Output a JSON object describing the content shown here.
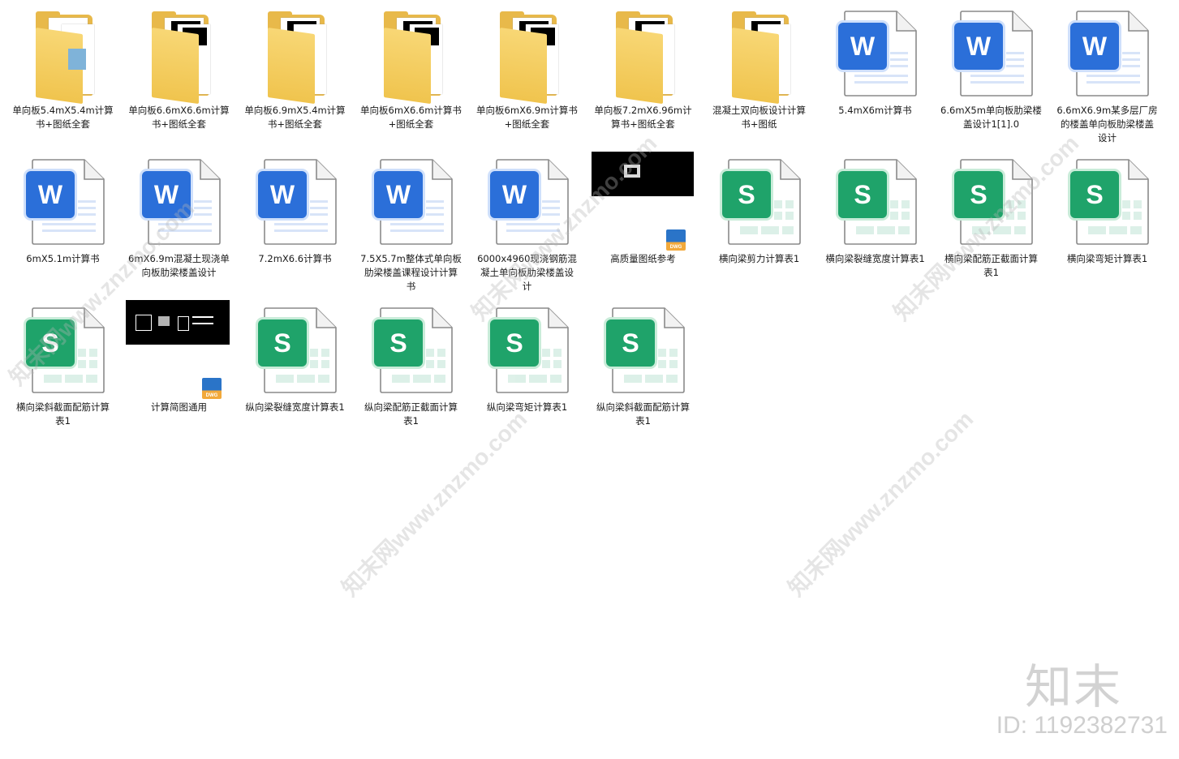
{
  "files": [
    {
      "label": "单向板5.4mX5.4m计算书+图纸全套",
      "kind": "folder",
      "icon": "folder-icon"
    },
    {
      "label": "单向板6.6mX6.6m计算书+图纸全套",
      "kind": "folder",
      "icon": "folder-icon"
    },
    {
      "label": "单向板6.9mX5.4m计算书+图纸全套",
      "kind": "folder",
      "icon": "folder-icon"
    },
    {
      "label": "单向板6mX6.6m计算书+图纸全套",
      "kind": "folder",
      "icon": "folder-icon"
    },
    {
      "label": "单向板6mX6.9m计算书+图纸全套",
      "kind": "folder",
      "icon": "folder-icon"
    },
    {
      "label": "单向板7.2mX6.96m计算书+图纸全套",
      "kind": "folder",
      "icon": "folder-icon"
    },
    {
      "label": "混凝土双向板设计计算书+图纸",
      "kind": "folder",
      "icon": "folder-icon"
    },
    {
      "label": "5.4mX6m计算书",
      "kind": "word",
      "icon": "word-doc-icon"
    },
    {
      "label": "6.6mX5m单向板肋梁楼盖设计1[1].0",
      "kind": "word",
      "icon": "word-doc-icon"
    },
    {
      "label": "6.6mX6.9m某多层厂房的楼盖单向板肋梁楼盖设计",
      "kind": "word",
      "icon": "word-doc-icon"
    },
    {
      "label": "6mX5.1m计算书",
      "kind": "word",
      "icon": "word-doc-icon"
    },
    {
      "label": "6mX6.9m混凝土现浇单向板肋梁楼盖设计",
      "kind": "word",
      "icon": "word-doc-icon"
    },
    {
      "label": "7.2mX6.6计算书",
      "kind": "word",
      "icon": "word-doc-icon"
    },
    {
      "label": "7.5X5.7m整体式单向板肋梁楼盖课程设计计算书",
      "kind": "word",
      "icon": "word-doc-icon"
    },
    {
      "label": "6000x4960现浇钢筋混凝土单向板肋梁楼盖设计",
      "kind": "word",
      "icon": "word-doc-icon"
    },
    {
      "label": "高质量图纸参考",
      "kind": "dwg",
      "icon": "dwg-drawing-icon"
    },
    {
      "label": "横向梁剪力计算表1",
      "kind": "sheet",
      "icon": "spreadsheet-icon"
    },
    {
      "label": "横向梁裂缝宽度计算表1",
      "kind": "sheet",
      "icon": "spreadsheet-icon"
    },
    {
      "label": "横向梁配筋正截面计算表1",
      "kind": "sheet",
      "icon": "spreadsheet-icon"
    },
    {
      "label": "横向梁弯矩计算表1",
      "kind": "sheet",
      "icon": "spreadsheet-icon"
    },
    {
      "label": "横向梁斜截面配筋计算表1",
      "kind": "sheet",
      "icon": "spreadsheet-icon"
    },
    {
      "label": "计算简图通用",
      "kind": "dwg2",
      "icon": "dwg-drawing-icon"
    },
    {
      "label": "纵向梁裂缝宽度计算表1",
      "kind": "sheet",
      "icon": "spreadsheet-icon"
    },
    {
      "label": "纵向梁配筋正截面计算表1",
      "kind": "sheet",
      "icon": "spreadsheet-icon"
    },
    {
      "label": "纵向梁弯矩计算表1",
      "kind": "sheet",
      "icon": "spreadsheet-icon"
    },
    {
      "label": "纵向梁斜截面配筋计算表1",
      "kind": "sheet",
      "icon": "spreadsheet-icon"
    }
  ],
  "word_letter": "W",
  "sheet_letter": "S",
  "dwg_text": "DWG",
  "watermark_text": "知末网www.znzmo.com",
  "brand": "知末",
  "id_text": "ID: 1192382731",
  "colors": {
    "word": "#2b6fd9",
    "sheet": "#1fa36a",
    "folder": "#f0c44e"
  }
}
